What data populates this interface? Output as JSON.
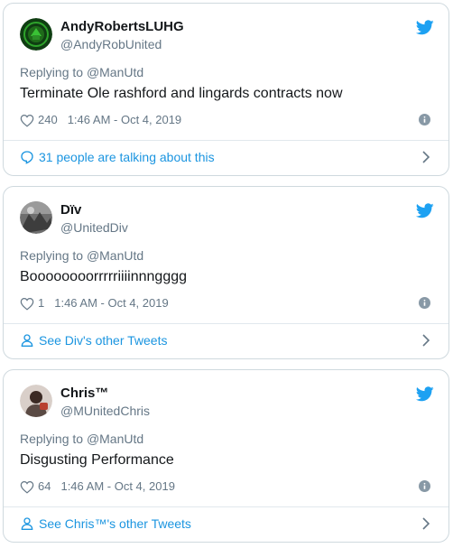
{
  "tweets": [
    {
      "name": "AndyRobertsLUHG",
      "handle": "@AndyRobUnited",
      "replying_prefix": "Replying to ",
      "replying_to": "@ManUtd",
      "text": "Terminate Ole rashford and lingards contracts now",
      "likes": "240",
      "timestamp": "1:46 AM - Oct 4, 2019",
      "footer_icon": "speech-bubble-icon",
      "footer_text": "31 people are talking about this"
    },
    {
      "name": "Dïv",
      "handle": "@UnitedDiv",
      "replying_prefix": "Replying to ",
      "replying_to": "@ManUtd",
      "text": "Boooooooorrrrriiiinnngggg",
      "likes": "1",
      "timestamp": "1:46 AM - Oct 4, 2019",
      "footer_icon": "person-icon",
      "footer_text": "See Div's other Tweets"
    },
    {
      "name": "Chris™",
      "handle": "@MUnitedChris",
      "replying_prefix": "Replying to ",
      "replying_to": "@ManUtd",
      "text": "Disgusting Performance",
      "likes": "64",
      "timestamp": "1:46 AM - Oct 4, 2019",
      "footer_icon": "person-icon",
      "footer_text": "See Chris™'s other Tweets"
    }
  ],
  "colors": {
    "link_blue": "#1b95e0",
    "twitter_blue": "#1da1f2",
    "muted_text": "#657786",
    "primary_text": "#14171a",
    "border": "#cfd9de"
  }
}
